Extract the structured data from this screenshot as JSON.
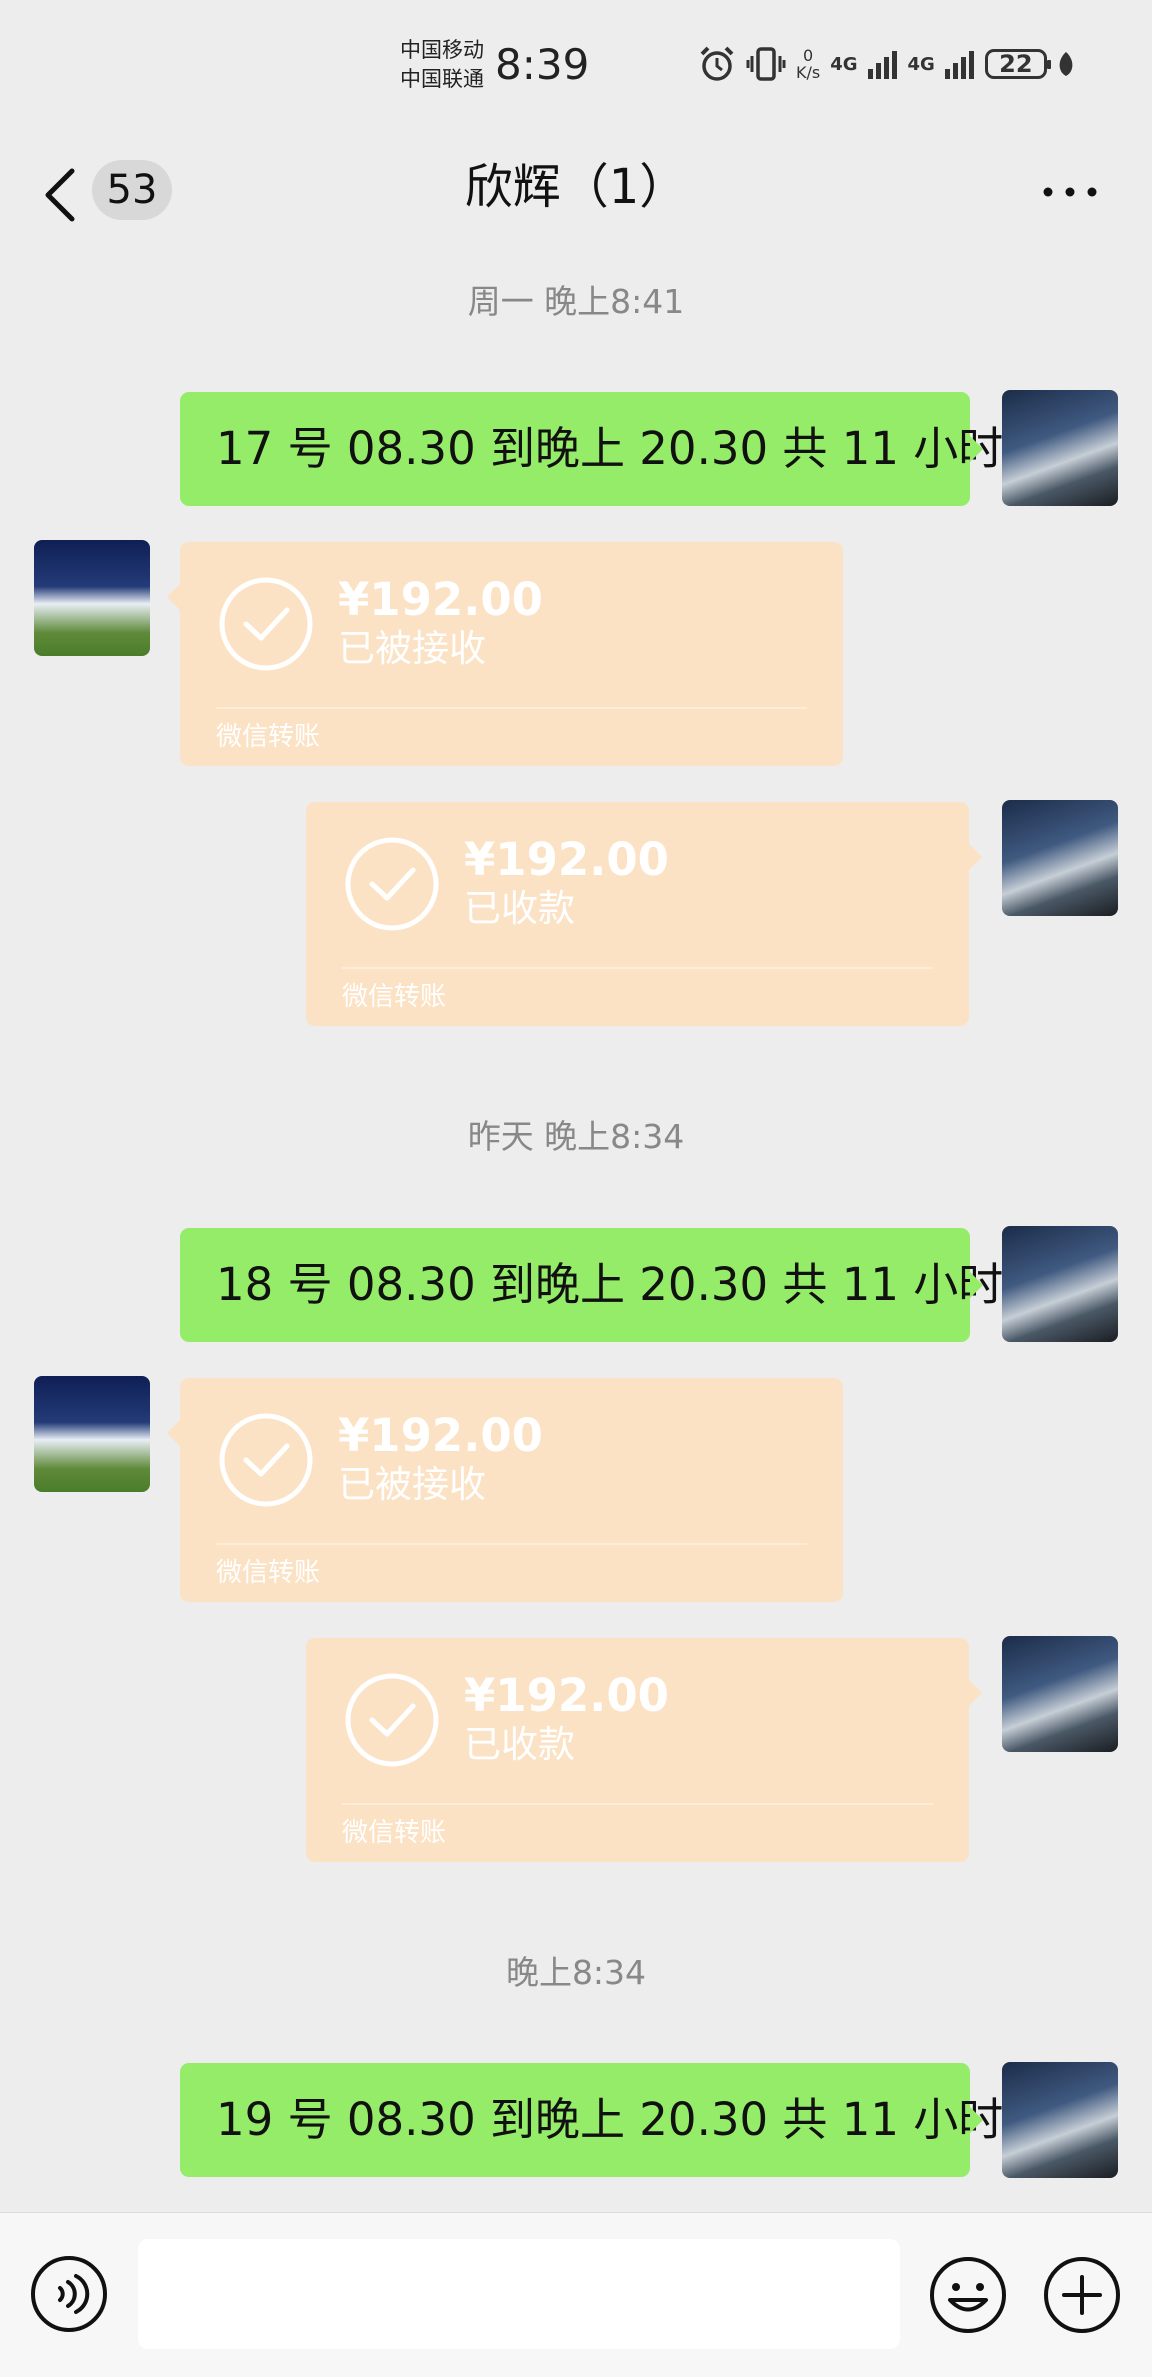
{
  "status_bar": {
    "carrier1": "中国移动",
    "carrier2": "中国联通",
    "time": "8:39",
    "net_speed_value": "0",
    "net_speed_unit": "K/s",
    "signal1": "4G",
    "signal2": "4G",
    "battery": "22"
  },
  "header": {
    "unread_count": "53",
    "title": "欣辉（1）"
  },
  "chat": {
    "timestamps": [
      "周一 晚上8:41",
      "昨天 晚上8:34",
      "晚上8:34"
    ],
    "messages": [
      "17 号 08.30 到晚上 20.30 共 11 小时",
      "18 号 08.30 到晚上 20.30 共 11 小时",
      "19 号 08.30 到晚上 20.30 共 11 小时"
    ],
    "transfers": [
      {
        "amount": "¥192.00",
        "status": "已被接收",
        "label": "微信转账"
      },
      {
        "amount": "¥192.00",
        "status": "已收款",
        "label": "微信转账"
      },
      {
        "amount": "¥192.00",
        "status": "已被接收",
        "label": "微信转账"
      },
      {
        "amount": "¥192.00",
        "status": "已收款",
        "label": "微信转账"
      }
    ]
  },
  "colors": {
    "text_bubble": "#95ec69",
    "transfer_bubble": "#fce2c4",
    "background": "#ededed"
  },
  "icons": {
    "back": "chevron-left-icon",
    "more": "more-dots-icon",
    "voice": "voice-icon",
    "emoji": "emoji-icon",
    "plus": "plus-icon",
    "check": "check-circle-icon"
  }
}
